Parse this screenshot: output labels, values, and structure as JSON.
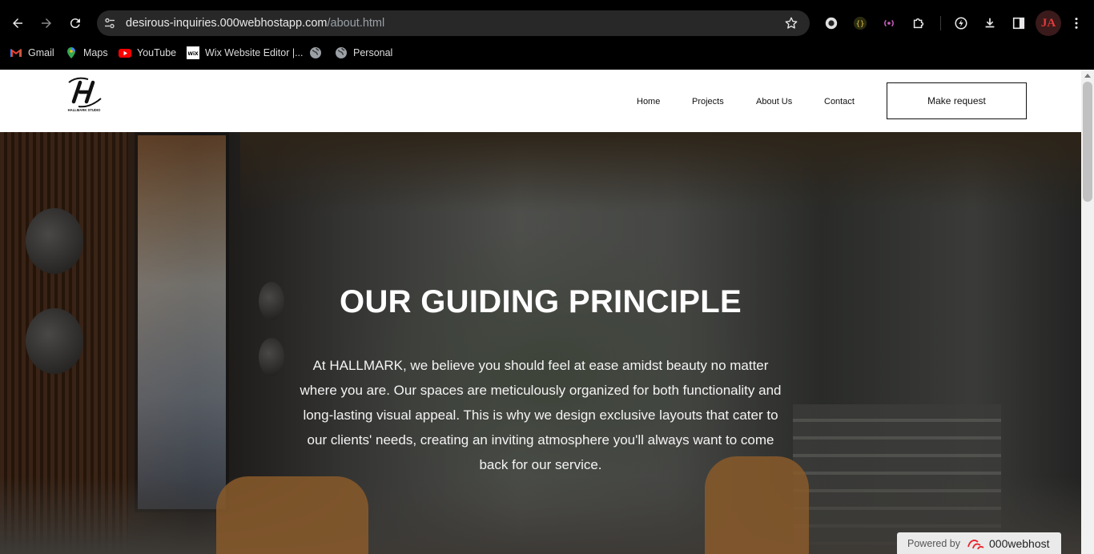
{
  "browser": {
    "url_host": "desirous-inquiries.000webhostapp.com",
    "url_path": "/about.html",
    "bookmarks": [
      {
        "label": "Gmail",
        "icon": "gmail-icon"
      },
      {
        "label": "Maps",
        "icon": "maps-icon"
      },
      {
        "label": "YouTube",
        "icon": "youtube-icon"
      },
      {
        "label": "Wix Website Editor |...",
        "icon": "wix-icon"
      },
      {
        "label": "",
        "icon": "globe-icon"
      },
      {
        "label": "Personal",
        "icon": "globe-icon"
      }
    ],
    "profile_initials": "JA",
    "accent_color": "#e23b3b"
  },
  "site": {
    "logo_text": "HALLMARK STUDIO",
    "nav": {
      "home": "Home",
      "projects": "Projects",
      "about": "About Us",
      "contact": "Contact"
    },
    "cta_label": "Make request"
  },
  "hero": {
    "title": "OUR GUIDING PRINCIPLE",
    "text": "At HALLMARK, we believe you should feel at ease amidst beauty no matter where you are. Our spaces are meticulously organized for both functionality and long-lasting visual appeal. This is why we design exclusive layouts that cater to our clients' needs, creating an inviting atmosphere you'll always want to come back for our service."
  },
  "badge": {
    "powered_by": "Powered by",
    "brand": "000webhost"
  }
}
